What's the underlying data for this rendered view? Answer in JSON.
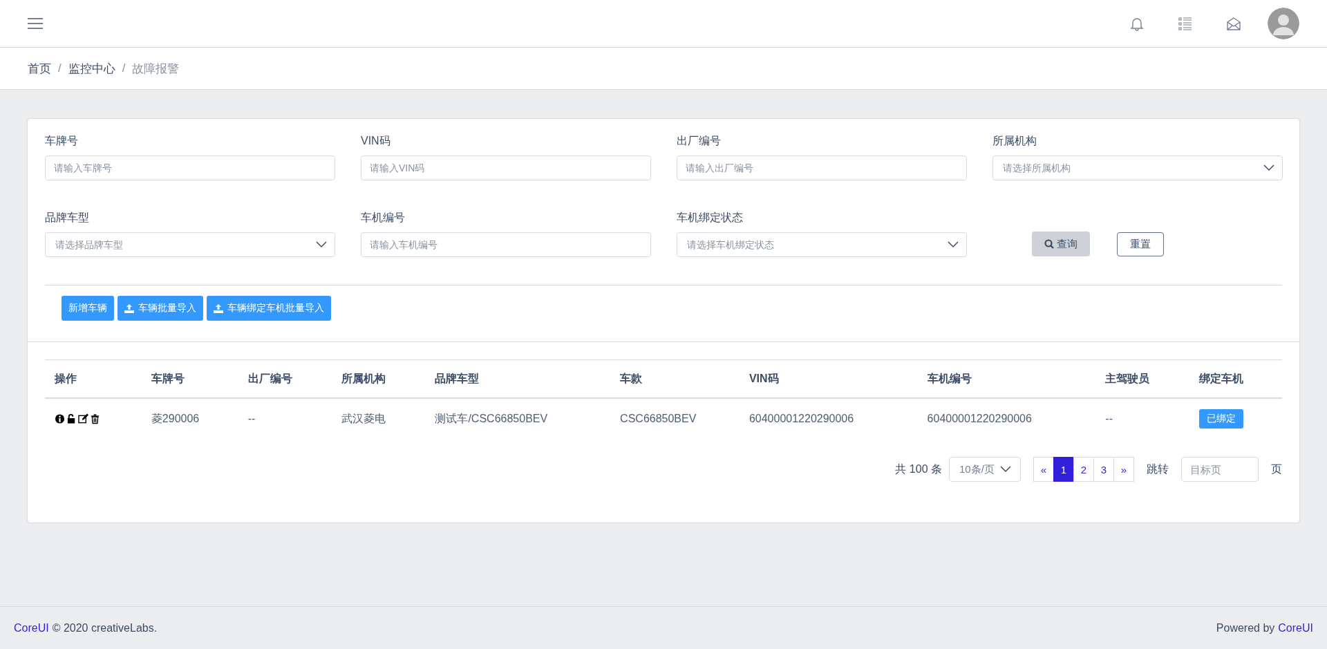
{
  "breadcrumb": [
    {
      "label": "首页",
      "current": false
    },
    {
      "label": "监控中心",
      "current": false,
      "separator": "/"
    },
    {
      "label": "故障报警",
      "current": true,
      "separator": "/"
    }
  ],
  "filters": [
    {
      "label": "车牌号",
      "kind": "input",
      "placeholder": "请输入车牌号"
    },
    {
      "label": "VIN码",
      "kind": "input",
      "placeholder": "请输入VIN码"
    },
    {
      "label": "出厂编号",
      "kind": "input",
      "placeholder": "请输入出厂编号"
    },
    {
      "label": "所属机构",
      "kind": "select",
      "placeholder": "请选择所属机构"
    },
    {
      "label": "品牌车型",
      "kind": "select",
      "placeholder": "请选择品牌车型"
    },
    {
      "label": "车机编号",
      "kind": "input",
      "placeholder": "请输入车机编号"
    },
    {
      "label": "车机绑定状态",
      "kind": "select",
      "placeholder": "请选择车机绑定状态"
    }
  ],
  "search_button": "查询",
  "reset_button": "重置",
  "actions": [
    {
      "label": "新增车辆",
      "kind": "plain"
    },
    {
      "label": "车辆批量导入",
      "kind": "upload"
    },
    {
      "label": "车辆绑定车机批量导入",
      "kind": "upload"
    }
  ],
  "table": {
    "columns": [
      "操作",
      "车牌号",
      "出厂编号",
      "所属机构",
      "品牌车型",
      "车款",
      "VIN码",
      "车机编号",
      "主驾驶员",
      "绑定车机"
    ],
    "rows": [
      {
        "cells": [
          "",
          "菱290006",
          "--",
          "武汉菱电",
          "测试车/CSC66850BEV",
          "CSC66850BEV",
          "60400001220290006",
          "60400001220290006",
          "--",
          "已绑定"
        ]
      }
    ]
  },
  "pagination": {
    "total": "共 100 条",
    "page_size": "10条/页",
    "pages": [
      {
        "label": "«",
        "selected": false
      },
      {
        "label": "1",
        "selected": true
      },
      {
        "label": "2",
        "selected": false
      },
      {
        "label": "3",
        "selected": false
      },
      {
        "label": "»",
        "selected": false
      }
    ],
    "jump_label": "跳转",
    "jump_placeholder": "目标页",
    "suffix": "页"
  },
  "footer": {
    "brand": "CoreUI",
    "copyright": "© 2020 creativeLabs.",
    "powered_by": "Powered by",
    "powered_link": "CoreUI"
  }
}
